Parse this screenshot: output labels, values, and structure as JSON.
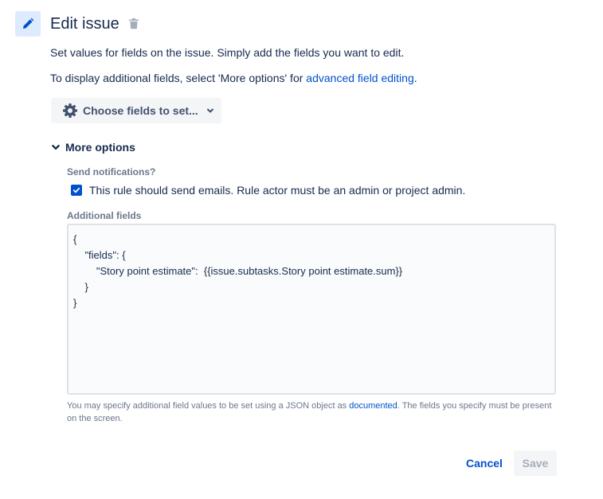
{
  "header": {
    "title": "Edit issue"
  },
  "intro": {
    "line1": "Set values for fields on the issue. Simply add the fields you want to edit.",
    "line2_prefix": "To display additional fields, select 'More options' for ",
    "line2_link": "advanced field editing",
    "line2_suffix": "."
  },
  "choose_fields": {
    "label": "Choose fields to set..."
  },
  "more_options": {
    "label": "More options",
    "send_notifications_label": "Send notifications?",
    "send_emails_checked": true,
    "send_emails_label": "This rule should send emails. Rule actor must be an admin or project admin.",
    "additional_fields_label": "Additional fields",
    "additional_fields_value": "{\n    \"fields\": {\n        \"Story point estimate\":  {{issue.subtasks.Story point estimate.sum}}\n    }\n}",
    "help_prefix": "You may specify additional field values to be set using a JSON object as ",
    "help_link": "documented",
    "help_suffix": ". The fields you specify must be present on the screen."
  },
  "footer": {
    "cancel_label": "Cancel",
    "save_label": "Save"
  },
  "colors": {
    "accent": "#0052CC",
    "icon_bg": "#DEEBFF",
    "text": "#172B4D",
    "muted": "#6B778C"
  },
  "icons": {
    "action": "pencil-icon",
    "delete": "trash-icon",
    "settings": "gear-icon",
    "dropdown": "chevron-down-icon",
    "expand": "chevron-down-icon",
    "checkbox": "checkmark-icon"
  }
}
